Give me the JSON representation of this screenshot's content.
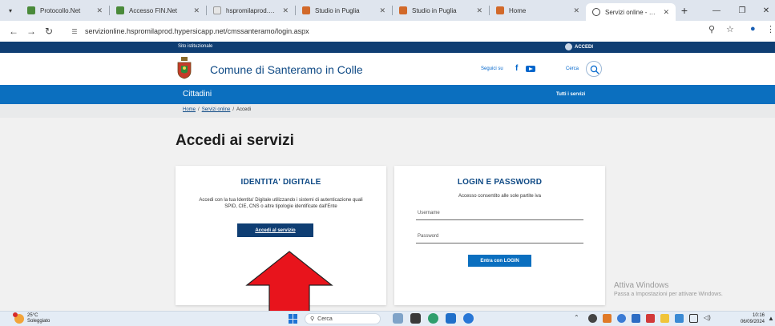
{
  "browser": {
    "tabs": [
      {
        "label": "Protocollo.Net",
        "icon_color": "#4a8a3a"
      },
      {
        "label": "Accesso FIN.Net",
        "icon_color": "#4a8a3a"
      },
      {
        "label": "hspromilaprod.hyperi",
        "icon_color": "#7a7a7a"
      },
      {
        "label": "Studio in Puglia",
        "icon_color": "#d2692a"
      },
      {
        "label": "Studio in Puglia",
        "icon_color": "#d2692a"
      },
      {
        "label": "Home",
        "icon_color": "#d2692a"
      },
      {
        "label": "Servizi online - Comu",
        "icon_color": "#444444"
      }
    ],
    "active_tab_index": 6,
    "url": "servizionline.hspromilaprod.hypersicapp.net/cmssanteramo/login.aspx"
  },
  "site": {
    "topbar_label": "Sito istituzionale",
    "accedi_label": "ACCEDI",
    "municipality_name": "Comune di Santeramo in Colle",
    "seguici_label": "Seguici su",
    "cerca_label": "Cerca",
    "nav_section": "Cittadini",
    "nav_all_services": "Tutti i servizi",
    "breadcrumb": [
      "Home",
      "/",
      "Servizi online",
      "/",
      "Accedi"
    ],
    "accent_color": "#0f4a85",
    "nav_color": "#0b6fbf"
  },
  "main": {
    "page_title": "Accedi ai servizi",
    "digital_identity": {
      "title": "IDENTITA' DIGITALE",
      "description": "Accedi con la tua Identita' Digitale utilizzando i sistemi di autenticazione quali SPID, CIE, CNS o altre tipologie identificate dall'Ente",
      "button_label": "Accedi al servizio"
    },
    "login_password": {
      "title": "LOGIN E PASSWORD",
      "description": "Accesso consentito alle sole partite iva",
      "username_label": "Username",
      "password_label": "Password",
      "button_label": "Entra con LOGIN"
    },
    "arrow_color": "#e8141c"
  },
  "watermark": {
    "line1": "Attiva Windows",
    "line2": "Passa a Impostazioni per attivare Windows."
  },
  "taskbar": {
    "temperature": "25°C",
    "weather": "Soleggiato",
    "search_label": "Cerca",
    "time": "10:16",
    "date": "06/09/2024"
  }
}
